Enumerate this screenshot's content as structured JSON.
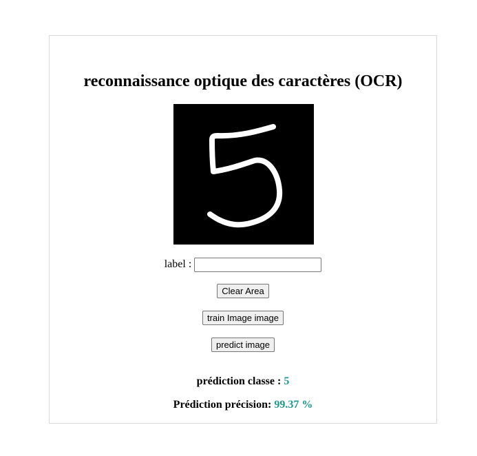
{
  "title": "reconnaissance optique des caractères (OCR)",
  "drawing": {
    "digit": "5"
  },
  "form": {
    "label_text": "label :",
    "label_value": "",
    "label_placeholder": ""
  },
  "buttons": {
    "clear": "Clear Area",
    "train": "train Image image",
    "predict": "predict image"
  },
  "results": {
    "class_label": "prédiction classe :",
    "class_value": "5",
    "precision_label": "Prédiction précision:",
    "precision_value": "99.37 %"
  },
  "colors": {
    "result_value": "#1a9a8a",
    "canvas_bg": "#000000",
    "stroke": "#ffffff"
  }
}
